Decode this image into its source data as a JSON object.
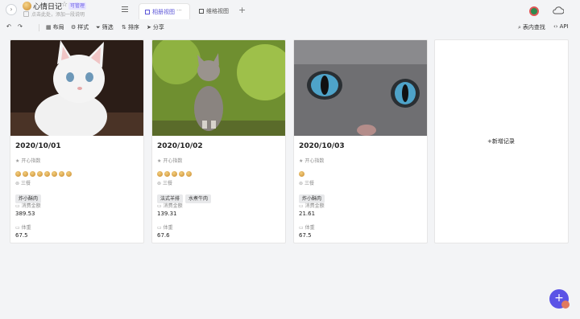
{
  "app": {
    "title": "心情日记",
    "badge": "可管理",
    "description": "点击此处，添加一段说明"
  },
  "tabs": [
    {
      "label": "相册视图",
      "active": true
    },
    {
      "label": "维格视图",
      "active": false
    }
  ],
  "tab_more": "···",
  "add_tab": "+",
  "toolbar": {
    "layout": "布局",
    "style": "样式",
    "filter": "筛选",
    "sort": "排序",
    "share": "分享",
    "find": "表内查找",
    "api": "API"
  },
  "fields": {
    "happiness": "开心指数",
    "meals": "三餐",
    "amount": "消费金额",
    "weight": "体重"
  },
  "records": [
    {
      "date": "2020/10/01",
      "happiness": 8,
      "meals": [
        "炸小酥肉"
      ],
      "amount": "389.53",
      "weight": "67.5"
    },
    {
      "date": "2020/10/02",
      "happiness": 5,
      "meals": [
        "法式羊排",
        "水煮牛肉"
      ],
      "amount": "139.31",
      "weight": "67.6"
    },
    {
      "date": "2020/10/03",
      "happiness": 1,
      "meals": [
        "炸小酥肉"
      ],
      "amount": "21.61",
      "weight": "67.5"
    }
  ],
  "new_record": "新增记录",
  "fab": "+",
  "colors": {
    "accent": "#5b53e6",
    "tag_bg": "#e8e9eb"
  }
}
